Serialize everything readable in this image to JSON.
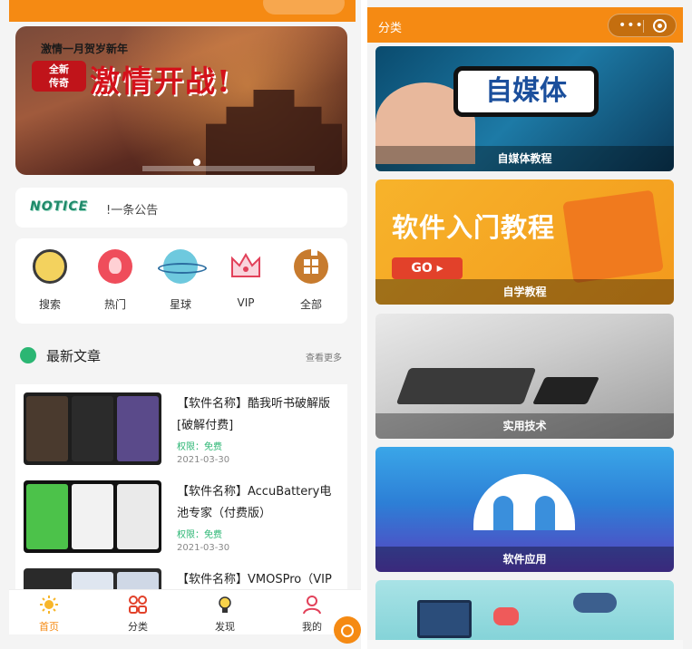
{
  "left": {
    "banner": {
      "headline": "激情一月贺岁新年",
      "badge": "全新\n传奇",
      "slogan": "激情开战!"
    },
    "notice": {
      "logo": "NOTICE",
      "text": "!一条公告"
    },
    "quick_nav": [
      {
        "label": "搜索",
        "icon": "search-icon"
      },
      {
        "label": "热门",
        "icon": "flame-icon"
      },
      {
        "label": "星球",
        "icon": "planet-icon"
      },
      {
        "label": "VIP",
        "icon": "crown-icon"
      },
      {
        "label": "全部",
        "icon": "grid-icon"
      }
    ],
    "section": {
      "title": "最新文章",
      "more": "查看更多"
    },
    "articles": [
      {
        "title": "【软件名称】酷我听书破解版[破解付费]",
        "permission": "权限：免费",
        "date": "2021-03-30"
      },
      {
        "title": "【软件名称】AccuBattery电池专家（付费版）",
        "permission": "权限：免费",
        "date": "2021-03-30"
      },
      {
        "title": "【软件名称】VMOSPro（VIP",
        "permission": "",
        "date": ""
      }
    ],
    "tabbar": [
      {
        "label": "首页",
        "icon": "sun-icon",
        "active": true
      },
      {
        "label": "分类",
        "icon": "category-icon",
        "active": false
      },
      {
        "label": "发现",
        "icon": "bulb-icon",
        "active": false
      },
      {
        "label": "我的",
        "icon": "user-icon",
        "active": false
      }
    ]
  },
  "right": {
    "title": "分类",
    "capsule": {
      "more": "•••"
    },
    "categories": [
      {
        "caption": "自媒体教程",
        "banner_text": "自媒体"
      },
      {
        "caption": "自学教程",
        "banner_text": "软件入门教程",
        "button": "GO ▸"
      },
      {
        "caption": "实用技术"
      },
      {
        "caption": "软件应用"
      },
      {
        "caption": ""
      }
    ]
  },
  "colors": {
    "accent": "#f58a13",
    "green": "#2bb673",
    "notice_logo": "#1f8a6a"
  }
}
